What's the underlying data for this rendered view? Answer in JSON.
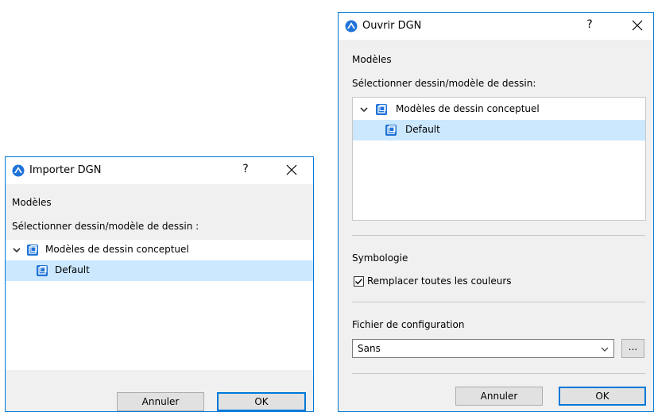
{
  "import_dialog": {
    "title": "Importer DGN",
    "help_label": "?",
    "section_label": "Modèles",
    "select_label": "Sélectionner dessin/modèle de dessin :",
    "tree": {
      "parent_label": "Modèles de dessin conceptuel",
      "child_label": "Default"
    },
    "cancel_label": "Annuler",
    "ok_label": "OK"
  },
  "open_dialog": {
    "title": "Ouvrir DGN",
    "help_label": "?",
    "section_label": "Modèles",
    "select_label": "Sélectionner dessin/modèle de dessin:",
    "tree": {
      "parent_label": "Modèles de dessin conceptuel",
      "child_label": "Default"
    },
    "symbology_label": "Symbologie",
    "replace_colors": {
      "label": "Remplacer toutes les couleurs",
      "checked": true
    },
    "config_label": "Fichier de configuration",
    "config_value": "Sans",
    "browse_label": "...",
    "cancel_label": "Annuler",
    "ok_label": "OK"
  },
  "icons": {
    "app": "archicad-app-icon",
    "node": "drawing-model-icon",
    "expand": "chevron-down-icon",
    "close": "close-icon"
  },
  "colors": {
    "accent": "#0078d7",
    "selection": "#cce8ff",
    "node_icon": "#1e73d8"
  }
}
